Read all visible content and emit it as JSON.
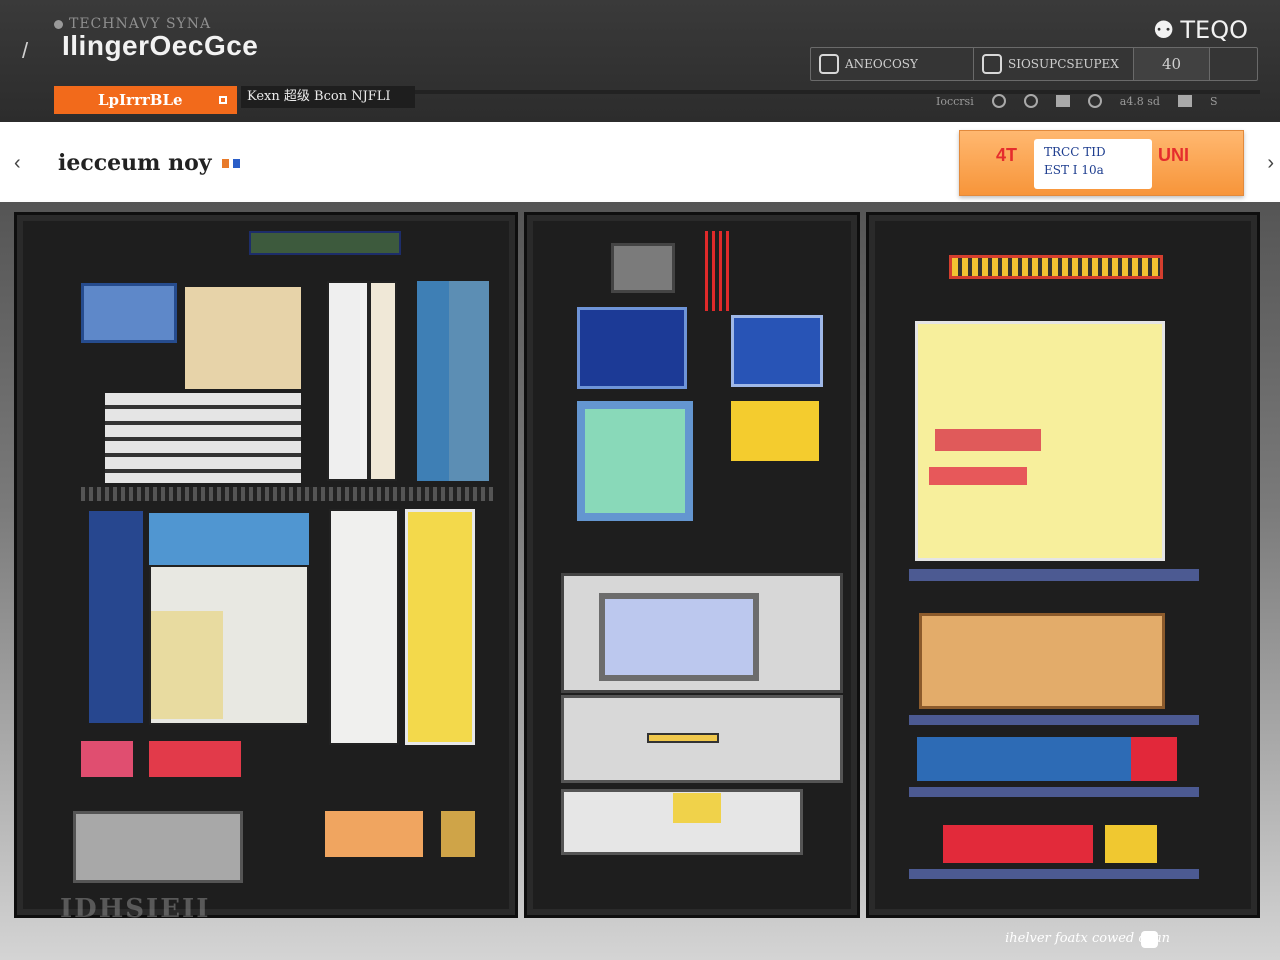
{
  "header": {
    "brand_subtitle": "TECHNAVY SYNA",
    "brand_title": "IlingerOecGce",
    "top_right_label": "TEQO",
    "segments": [
      {
        "label": "ANEOCOSY",
        "icon": "monitor-icon"
      },
      {
        "label": "SIOSUPCSEUPEX",
        "icon": "display-icon"
      },
      {
        "label": "40"
      },
      {
        "label": ""
      }
    ],
    "active_tab": "LpIrrrBLe",
    "second_tab": "Kexn 超级 Bcon NJFLI",
    "toolbar": {
      "label_left": "Ioccrsi",
      "label_mid": "a4.8 sd",
      "label_right": "S"
    }
  },
  "subbar": {
    "title": "iecceum noy",
    "promo": {
      "line1": "TRCC TID",
      "line2": "EST I 10a",
      "left_text": "4T",
      "right_text": "UNI"
    }
  },
  "stage": {
    "footer_label": "IDHSIEII",
    "footer_text": "ihelver foatx cowed oean"
  },
  "colors": {
    "accent": "#f26a1b",
    "header_bg": "#2f2f2f",
    "rack_frame": "#1e1e1e"
  }
}
